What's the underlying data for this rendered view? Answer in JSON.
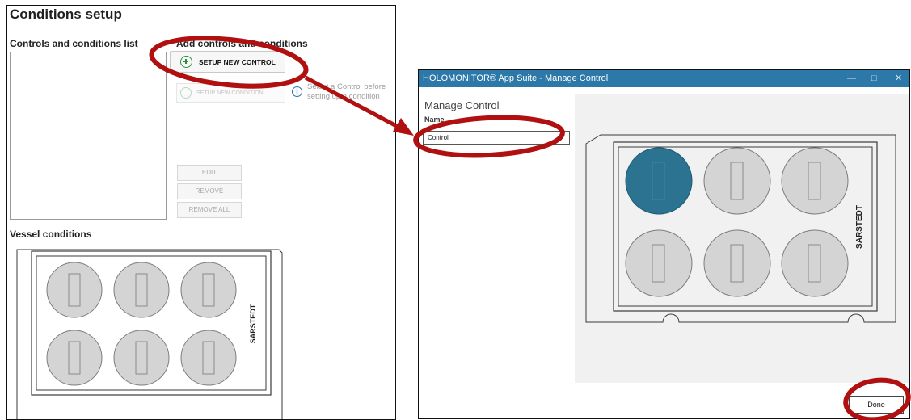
{
  "left_panel": {
    "title": "Conditions setup",
    "list_header": "Controls and conditions list",
    "add_header": "Add controls and conditions",
    "setup_control_label": "SETUP NEW CONTROL",
    "setup_condition_label": "SETUP NEW CONDITION",
    "hint": "Select a Control before setting up a condition",
    "edit_label": "EDIT",
    "remove_label": "REMOVE",
    "remove_all_label": "REMOVE ALL",
    "vessel_header": "Vessel conditions",
    "plate_brand": "SARSTEDT"
  },
  "dialog": {
    "title": "HOLOMONITOR® App Suite - Manage Control",
    "controls": {
      "minimize": "—",
      "maximize": "□",
      "close": "✕"
    },
    "heading": "Manage Control",
    "name_label": "Name",
    "name_value": "Control",
    "done_label": "Done",
    "plate_brand": "SARSTEDT",
    "selected_well": 1
  },
  "icons": {
    "add": "plus-circle-icon",
    "info": "info-icon"
  },
  "colors": {
    "titlebar": "#2c78a8",
    "selected_well": "#2b7390",
    "annotation": "#b01010"
  }
}
